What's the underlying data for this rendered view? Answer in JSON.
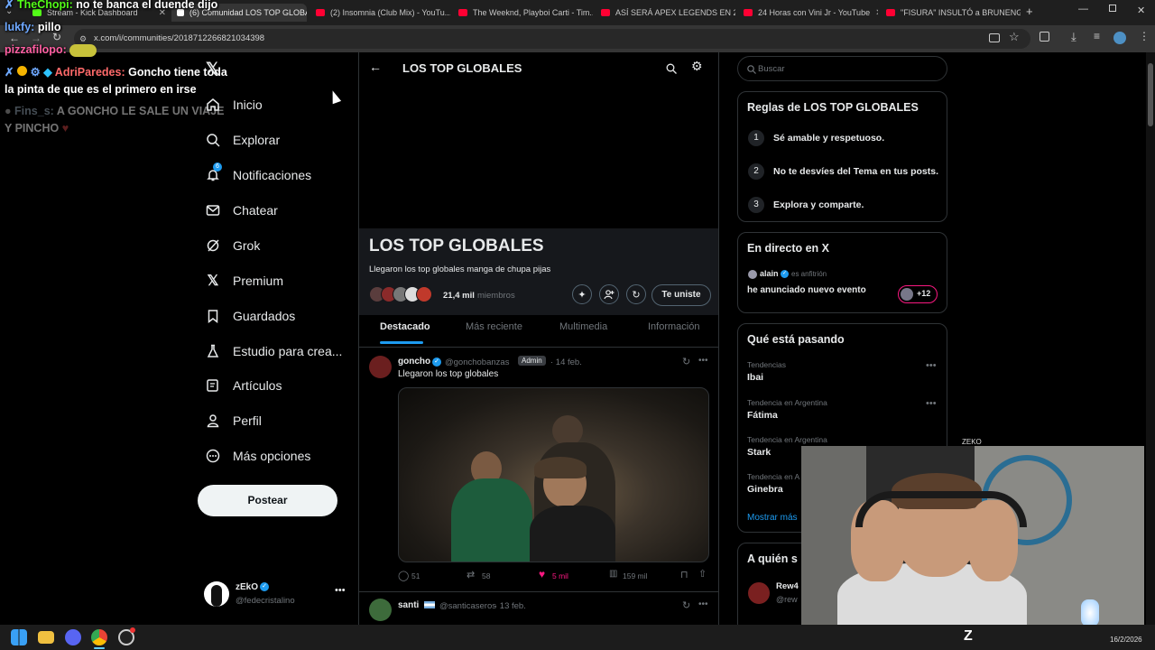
{
  "browser": {
    "tabs": [
      {
        "title": "Stream - Kick Dashboard",
        "fav": "#53fc18"
      },
      {
        "title": "(6) Comunidad LOS TOP GLOBA...",
        "fav": "#ffffff"
      },
      {
        "title": "(2) Insomnia (Club Mix) - YouTu...",
        "fav": "#ff0033"
      },
      {
        "title": "The Weeknd, Playboi Carti - Tim...",
        "fav": "#ff0033"
      },
      {
        "title": "ASÍ SERÁ APEX LEGENDS EN 20...",
        "fav": "#ff0033"
      },
      {
        "title": "24 Horas con Vini Jr - YouTube",
        "fav": "#ff0033"
      },
      {
        "title": "\"FISURA\" INSULTÓ a BRUNENG...",
        "fav": "#ff0033"
      }
    ],
    "url": "x.com/i/communities/2018712266821034398"
  },
  "chat": [
    {
      "user": "TheChopi:",
      "text": "no te banca el duende dijo",
      "user_color": "#53fc18"
    },
    {
      "user": "lukfy:",
      "text": "pillo",
      "user_color": "#6ea8ff"
    },
    {
      "user": "pizzafilopo:",
      "text": "",
      "user_color": "#ff5fa2"
    },
    {
      "user": "AdriParedes:",
      "text": "Goncho tiene toda",
      "user_color": "#ff6a6a"
    },
    {
      "user": "",
      "text": "la pinta de que es el primero en irse",
      "user_color": "#ffffff"
    },
    {
      "user": "Fins_s:",
      "text": "A GONCHO LE SALE UN VIAJE",
      "user_color": "#aaaaaa"
    },
    {
      "user": "",
      "text": "Y PINCHO",
      "user_color": "#aaaaaa"
    }
  ],
  "nav": {
    "items": [
      {
        "label": "Inicio",
        "icon": "home-icon"
      },
      {
        "label": "Explorar",
        "icon": "search-icon"
      },
      {
        "label": "Notificaciones",
        "icon": "bell-icon"
      },
      {
        "label": "Chatear",
        "icon": "mail-icon"
      },
      {
        "label": "Grok",
        "icon": "grok-icon"
      },
      {
        "label": "Premium",
        "icon": "x-logo-icon"
      },
      {
        "label": "Guardados",
        "icon": "bookmark-icon"
      },
      {
        "label": "Estudio para crea...",
        "icon": "flask-icon"
      },
      {
        "label": "Artículos",
        "icon": "article-icon"
      },
      {
        "label": "Perfil",
        "icon": "person-icon"
      },
      {
        "label": "Más opciones",
        "icon": "more-icon"
      }
    ],
    "notif_badge": "6",
    "post_label": "Postear",
    "account_name": "zEkO",
    "account_handle": "@fedecristalino"
  },
  "community": {
    "header_title": "LOS TOP GLOBALES",
    "name": "LOS TOP GLOBALES",
    "description": "Llegaron los top globales manga de chupa pijas",
    "members_count": "21,4 mil",
    "members_label": "miembros",
    "joined_label": "Te uniste",
    "tabs": [
      "Destacado",
      "Más reciente",
      "Multimedia",
      "Información"
    ],
    "active_tab": 0
  },
  "posts": [
    {
      "name": "goncho",
      "handle": "@gonchobanzas",
      "badge": "Admin",
      "date": "· 14 feb.",
      "text": "Llegaron los top globales",
      "replies": "51",
      "reposts": "58",
      "likes": "5 mil",
      "views": "159 mil"
    },
    {
      "name": "santi",
      "handle": "@santicaseros",
      "date": "· 13 feb."
    }
  ],
  "right": {
    "search_placeholder": "Buscar",
    "rules_title": "Reglas de LOS TOP GLOBALES",
    "rules": [
      {
        "num": "1",
        "text": "Sé amable y respetuoso."
      },
      {
        "num": "2",
        "text": "No te desvíes del Tema en tus posts."
      },
      {
        "num": "3",
        "text": "Explora y comparte."
      }
    ],
    "live_title": "En directo en X",
    "live_host": "alain",
    "live_host_role": "es anfitrión",
    "live_text": "he anunciado nuevo evento",
    "live_count": "+12",
    "trends_title": "Qué está pasando",
    "trends": [
      {
        "category": "Tendencias",
        "name": "Ibai"
      },
      {
        "category": "Tendencia en Argentina",
        "name": "Fátima"
      },
      {
        "category": "Tendencia en Argentina",
        "name": "Stark"
      },
      {
        "category": "Tendencia en A",
        "name": "Ginebra"
      }
    ],
    "show_more": "Mostrar más",
    "follow_title": "A quién s",
    "follow_name": "Rew4",
    "follow_handle": "@rew"
  },
  "webcam": {
    "label": "ZEKO"
  },
  "taskbar": {
    "date": "16/2/2026"
  },
  "colors": {
    "accent": "#1d9bf0",
    "like": "#f91880",
    "border": "#2f3336"
  }
}
